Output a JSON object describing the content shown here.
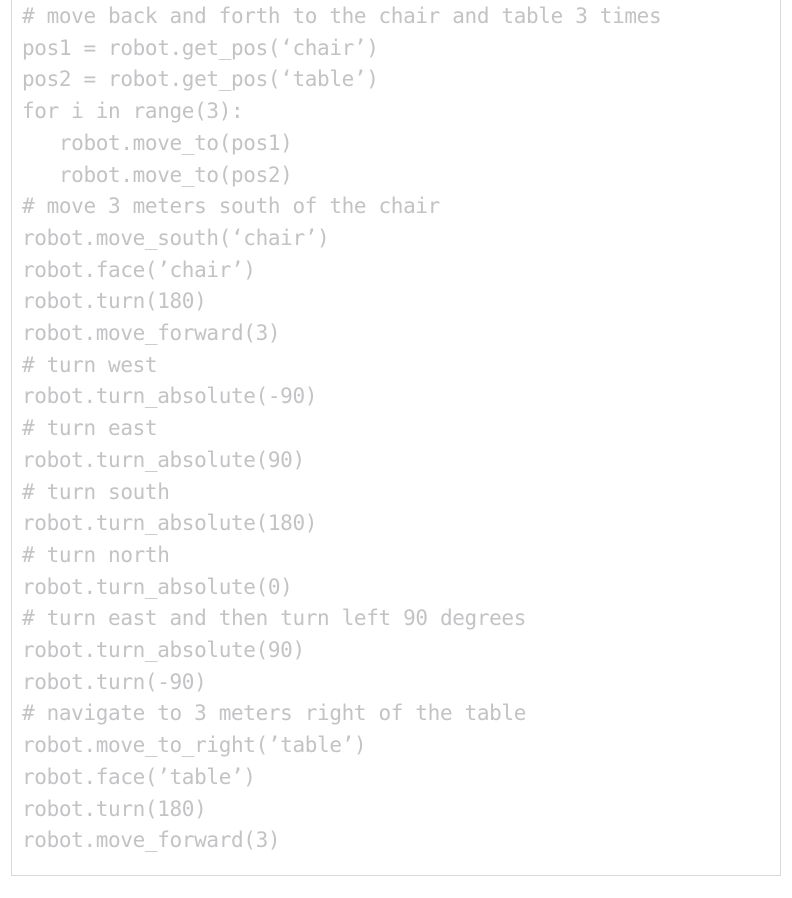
{
  "panel": {
    "kind": "code-block",
    "language": "python",
    "text_color": "#c3c3c6",
    "border_color": "#d9d9db",
    "background_color": "#ffffff"
  },
  "code": {
    "lines": [
      "# move back and forth to the chair and table 3 times",
      "pos1 = robot.get_pos(‘chair’)",
      "pos2 = robot.get_pos(‘table’)",
      "for i in range(3):",
      "   robot.move_to(pos1)",
      "   robot.move_to(pos2)",
      "# move 3 meters south of the chair",
      "robot.move_south(‘chair’)",
      "robot.face(’chair’)",
      "robot.turn(180)",
      "robot.move_forward(3)",
      "# turn west",
      "robot.turn_absolute(-90)",
      "# turn east",
      "robot.turn_absolute(90)",
      "# turn south",
      "robot.turn_absolute(180)",
      "# turn north",
      "robot.turn_absolute(0)",
      "# turn east and then turn left 90 degrees",
      "robot.turn_absolute(90)",
      "robot.turn(-90)",
      "# navigate to 3 meters right of the table",
      "robot.move_to_right(’table’)",
      "robot.face(’table’)",
      "robot.turn(180)",
      "robot.move_forward(3)"
    ]
  }
}
